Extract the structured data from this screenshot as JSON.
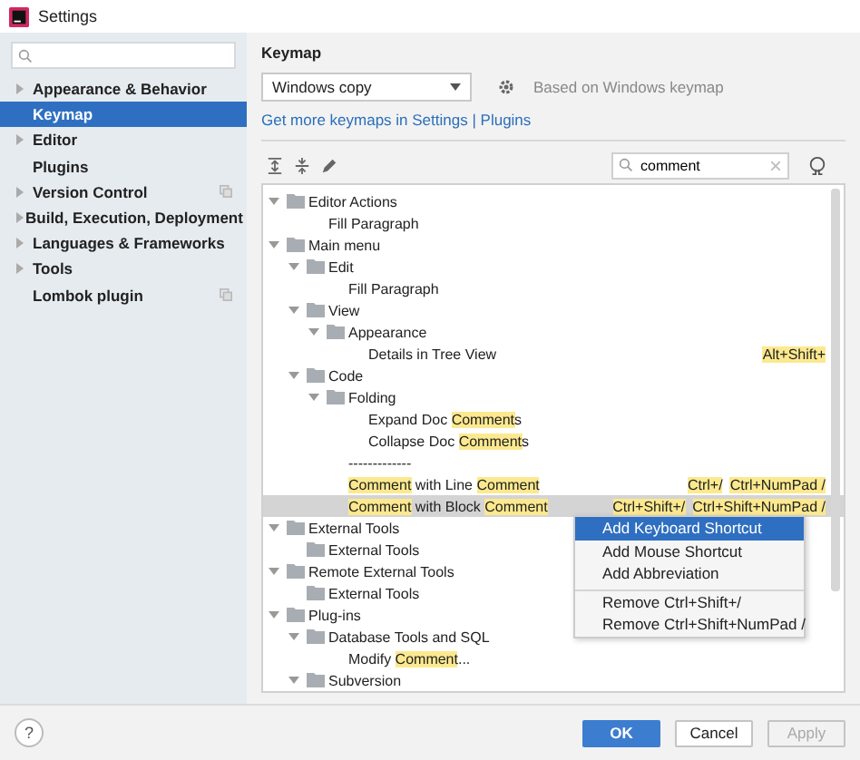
{
  "window": {
    "title": "Settings"
  },
  "sidebar": {
    "items": [
      {
        "label": "Appearance & Behavior",
        "expandable": true,
        "selected": false,
        "project_level": false
      },
      {
        "label": "Keymap",
        "expandable": false,
        "selected": true,
        "project_level": false
      },
      {
        "label": "Editor",
        "expandable": true,
        "selected": false,
        "project_level": false
      },
      {
        "label": "Plugins",
        "expandable": false,
        "selected": false,
        "project_level": false
      },
      {
        "label": "Version Control",
        "expandable": true,
        "selected": false,
        "project_level": true
      },
      {
        "label": "Build, Execution, Deployment",
        "expandable": true,
        "selected": false,
        "project_level": false
      },
      {
        "label": "Languages & Frameworks",
        "expandable": true,
        "selected": false,
        "project_level": false
      },
      {
        "label": "Tools",
        "expandable": true,
        "selected": false,
        "project_level": false
      },
      {
        "label": "Lombok plugin",
        "expandable": false,
        "selected": false,
        "project_level": true
      }
    ]
  },
  "keymap": {
    "title": "Keymap",
    "scheme": "Windows copy",
    "based_on": "Based on Windows keymap",
    "link": "Get more keymaps in Settings | Plugins",
    "search": {
      "value": "comment"
    },
    "tree": [
      {
        "kind": "group",
        "label": "Editor Actions",
        "expanded": true,
        "selected": false,
        "children": [
          {
            "kind": "action",
            "label": "Fill Paragraph",
            "selected": false
          }
        ]
      },
      {
        "kind": "group",
        "label": "Main menu",
        "expanded": true,
        "selected": false,
        "children": [
          {
            "kind": "group",
            "label": "Edit",
            "expanded": true,
            "selected": false,
            "children": [
              {
                "kind": "action",
                "label": "Fill Paragraph",
                "selected": false
              }
            ]
          },
          {
            "kind": "group",
            "label": "View",
            "expanded": true,
            "selected": false,
            "children": [
              {
                "kind": "group",
                "label": "Appearance",
                "expanded": true,
                "selected": false,
                "children": [
                  {
                    "kind": "action",
                    "label": "Details in Tree View",
                    "selected": false,
                    "shortcuts": [
                      "Alt+Shift+"
                    ]
                  }
                ]
              }
            ]
          },
          {
            "kind": "group",
            "label": "Code",
            "expanded": true,
            "selected": false,
            "children": [
              {
                "kind": "group",
                "label": "Folding",
                "expanded": true,
                "selected": false,
                "children": [
                  {
                    "kind": "action",
                    "label": "Expand Doc **Comment**s",
                    "selected": false
                  },
                  {
                    "kind": "action",
                    "label": "Collapse Doc **Comment**s",
                    "selected": false
                  }
                ]
              },
              {
                "kind": "action",
                "label": "-------------",
                "selected": false
              },
              {
                "kind": "action",
                "label": "**Comment** with Line **Comment**",
                "selected": false,
                "shortcuts": [
                  "Ctrl+/",
                  "Ctrl+NumPad /"
                ]
              },
              {
                "kind": "action",
                "label": "**Comment** with Block **Comment**",
                "selected": true,
                "shortcuts": [
                  "Ctrl+Shift+/",
                  "Ctrl+Shift+NumPad /"
                ]
              }
            ]
          }
        ]
      },
      {
        "kind": "group",
        "label": "External Tools",
        "expanded": true,
        "selected": false,
        "children": [
          {
            "kind": "group",
            "label": "External Tools",
            "selected": false
          }
        ]
      },
      {
        "kind": "group",
        "label": "Remote External Tools",
        "expanded": true,
        "selected": false,
        "children": [
          {
            "kind": "group",
            "label": "External Tools",
            "selected": false
          }
        ]
      },
      {
        "kind": "group",
        "label": "Plug-ins",
        "expanded": true,
        "selected": false,
        "children": [
          {
            "kind": "group",
            "label": "Database Tools and SQL",
            "expanded": true,
            "selected": false,
            "children": [
              {
                "kind": "action",
                "label": "Modify **Comment**...",
                "selected": false
              }
            ]
          },
          {
            "kind": "group",
            "label": "Subversion",
            "expanded": true,
            "selected": false
          }
        ]
      }
    ]
  },
  "context_menu": [
    {
      "label": "Add Keyboard Shortcut",
      "selected": true,
      "separator_before": false
    },
    {
      "label": "Add Mouse Shortcut",
      "selected": false,
      "separator_before": false
    },
    {
      "label": "Add Abbreviation",
      "selected": false,
      "separator_before": false
    },
    {
      "label": "Remove Ctrl+Shift+/",
      "selected": false,
      "separator_before": true
    },
    {
      "label": "Remove Ctrl+Shift+NumPad /",
      "selected": false,
      "separator_before": false
    }
  ],
  "help_button": {
    "label": "?"
  },
  "buttons": [
    {
      "label": "OK",
      "kind": "primary",
      "disabled": false
    },
    {
      "label": "Cancel",
      "kind": "normal",
      "disabled": false
    },
    {
      "label": "Apply",
      "kind": "normal",
      "disabled": true
    }
  ]
}
